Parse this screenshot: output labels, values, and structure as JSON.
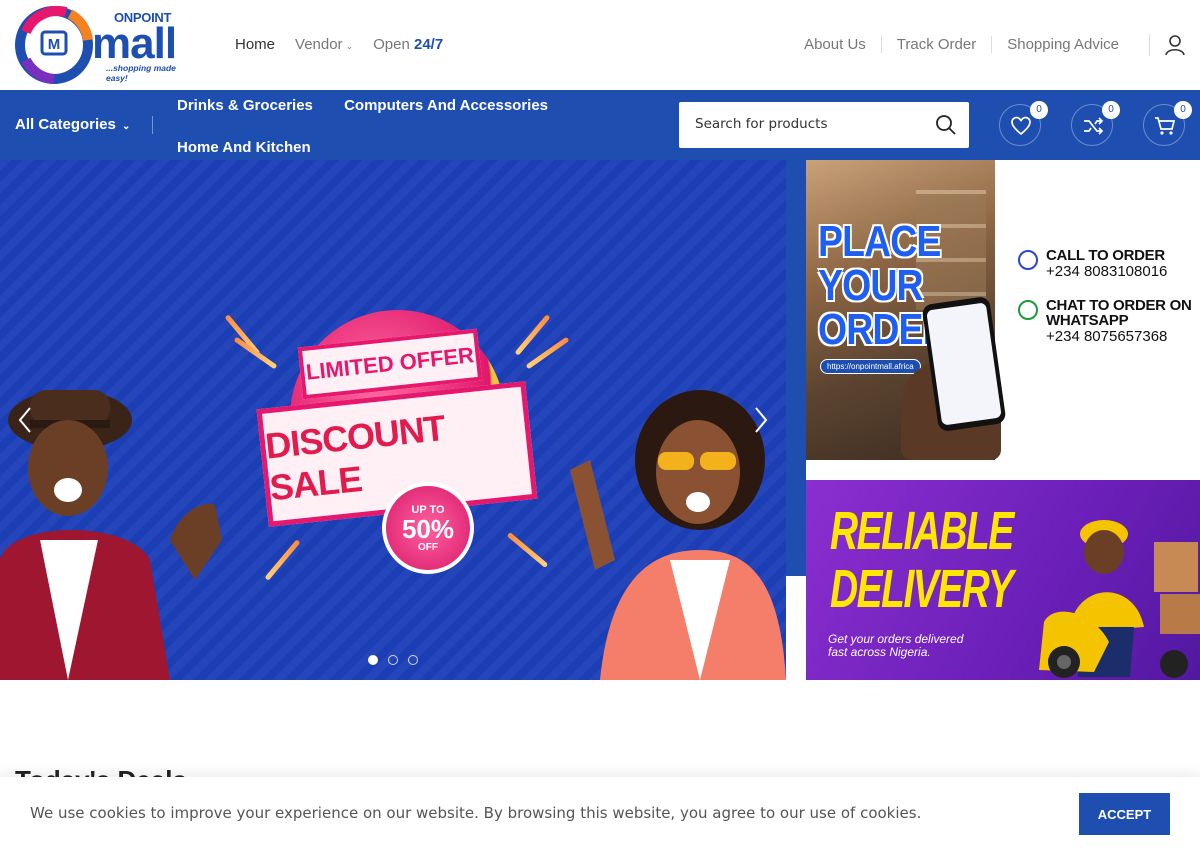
{
  "brand": {
    "onpoint": "ONPOINT",
    "mall": "mall",
    "tagline": "...shopping made easy!"
  },
  "nav": {
    "home": "Home",
    "vendor": "Vendor",
    "open_prefix": "Open ",
    "open_hours": "24/7",
    "about": "About Us",
    "track": "Track Order",
    "advice": "Shopping Advice"
  },
  "categories": {
    "all": "All Categories",
    "links": [
      "Drinks & Groceries",
      "Computers And Accessories",
      "Home And Kitchen"
    ]
  },
  "search": {
    "placeholder": "Search for products"
  },
  "counters": {
    "wishlist": "0",
    "compare": "0",
    "cart": "0"
  },
  "hero": {
    "limited": "LIMITED OFFER",
    "discount": "DISCOUNT SALE",
    "upto": "UP TO",
    "percent": "50%",
    "off": "OFF",
    "slides": 3,
    "active_slide": 0
  },
  "banner_order": {
    "headline": [
      "PLACE",
      "YOUR",
      "ORDER"
    ],
    "url": "https://onpointmall.africa",
    "call_label": "CALL TO ORDER",
    "call_number": "+234 8083108016",
    "chat_label_1": "CHAT TO ORDER ON",
    "chat_label_2": "WHATSAPP",
    "chat_number": "+234 8075657368"
  },
  "banner_delivery": {
    "line1": "RELIABLE",
    "line2": "DELIVERY",
    "sub1": "Get your orders delivered",
    "sub2": "fast across Nigeria."
  },
  "section": {
    "title": "Today's Deals"
  },
  "cookie": {
    "text": "We use cookies to improve your experience on our website. By browsing this website, you agree to our use of cookies.",
    "accept": "ACCEPT"
  },
  "colors": {
    "brand_blue": "#1e4fb0",
    "accent_pink": "#e6186d",
    "accent_yellow": "#ffe600"
  }
}
